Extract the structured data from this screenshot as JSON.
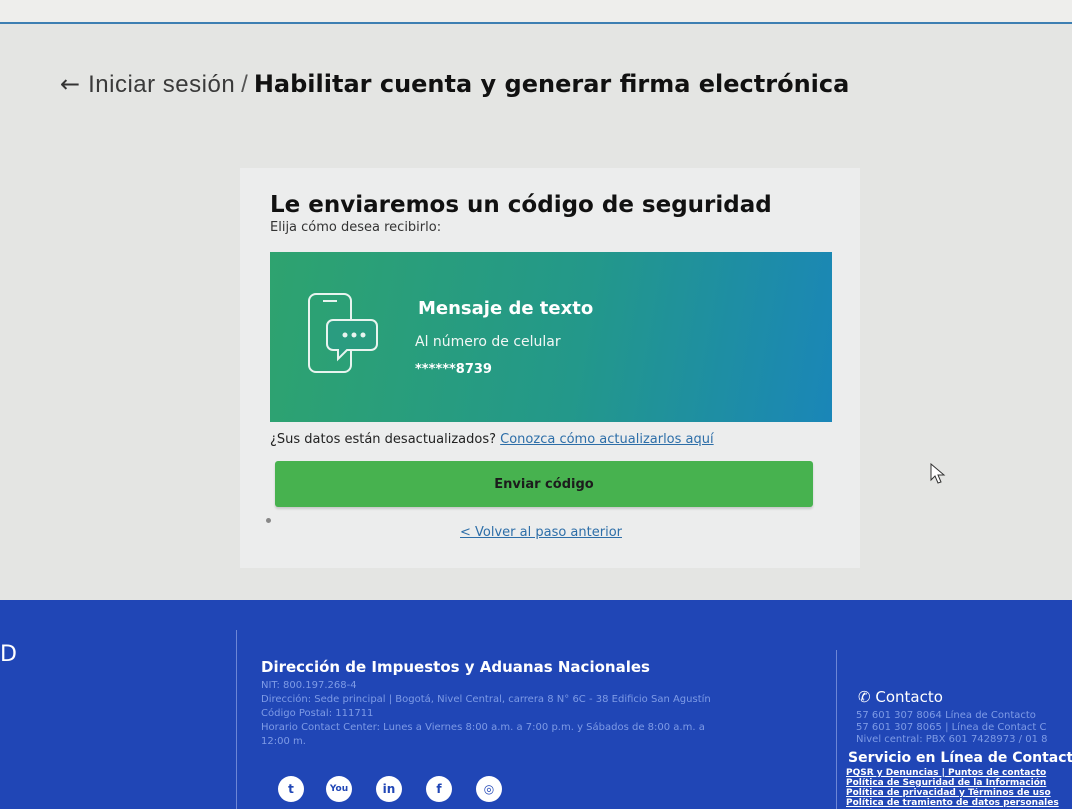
{
  "breadcrumb": {
    "back_arrow": "←",
    "parent": "Iniciar sesión",
    "separator": "/",
    "current": "Habilitar cuenta y generar firma electrónica"
  },
  "main": {
    "heading": "Le enviaremos un código de seguridad",
    "subheading": "Elija cómo desea recibirlo:",
    "option": {
      "icon": "phone-chat-icon",
      "title": "Mensaje de texto",
      "description": "Al número de celular",
      "number": "******8739",
      "colors": {
        "start": "#2ea36f",
        "end": "#1a86b8"
      }
    },
    "outdated_text": "¿Sus datos están desactualizados?",
    "outdated_link": "Conozca cómo actualizarlos aquí",
    "send_button": "Enviar código",
    "back_link": "< Volver al paso anterior"
  },
  "footer": {
    "left_mark": "D",
    "org_name": "Dirección de Impuestos y Aduanas Nacionales",
    "org_lines": [
      "NIT: 800.197.268-4",
      "Dirección: Sede principal | Bogotá, Nivel Central, carrera 8 N° 6C - 38 Edificio San Agustín",
      "Código Postal: 111711",
      "Horario Contact Center: Lunes a Viernes 8:00 a.m. a 7:00 p.m. y Sábados de 8:00 a.m. a",
      "12:00 m."
    ],
    "social": [
      {
        "name": "twitter-icon",
        "glyph": "t"
      },
      {
        "name": "youtube-icon",
        "glyph": "You"
      },
      {
        "name": "linkedin-icon",
        "glyph": "in"
      },
      {
        "name": "facebook-icon",
        "glyph": "f"
      },
      {
        "name": "instagram-icon",
        "glyph": "◎"
      }
    ],
    "contact_title": "Contacto",
    "contact_lines": [
      "57 601 307 8064 Línea de Contacto",
      "57 601 307 8065 | Línea de Contact C",
      "Nivel central: PBX 601 7428973 / 01 8"
    ],
    "service_title": "Servicio en Línea de Contacto",
    "service_links": [
      "PQSR y Denuncias | Puntos de contacto",
      "Política de Seguridad de la Información",
      "Política de privacidad y Términos de uso",
      "Política de tramiento de datos personales"
    ],
    "colors": {
      "background": "#2046b6",
      "muted_text": "#7e9be6"
    }
  },
  "colors": {
    "accent_green": "#47b24f",
    "link": "#2d6ea8"
  }
}
